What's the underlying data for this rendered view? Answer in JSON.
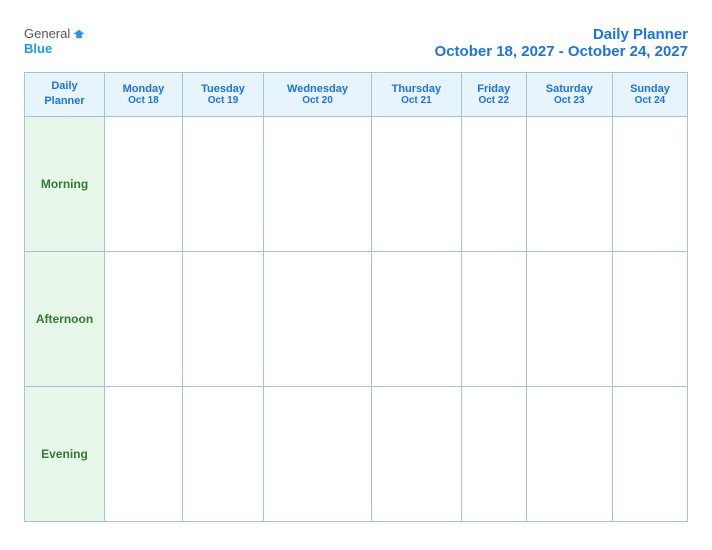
{
  "header": {
    "logo_general": "General",
    "logo_blue": "Blue",
    "title_line1": "Daily Planner",
    "title_line2": "October 18, 2027 - October 24, 2027"
  },
  "table": {
    "top_left_line1": "Daily",
    "top_left_line2": "Planner",
    "columns": [
      {
        "day": "Monday",
        "date": "Oct 18"
      },
      {
        "day": "Tuesday",
        "date": "Oct 19"
      },
      {
        "day": "Wednesday",
        "date": "Oct 20"
      },
      {
        "day": "Thursday",
        "date": "Oct 21"
      },
      {
        "day": "Friday",
        "date": "Oct 22"
      },
      {
        "day": "Saturday",
        "date": "Oct 23"
      },
      {
        "day": "Sunday",
        "date": "Oct 24"
      }
    ],
    "rows": [
      {
        "label": "Morning"
      },
      {
        "label": "Afternoon"
      },
      {
        "label": "Evening"
      }
    ]
  }
}
